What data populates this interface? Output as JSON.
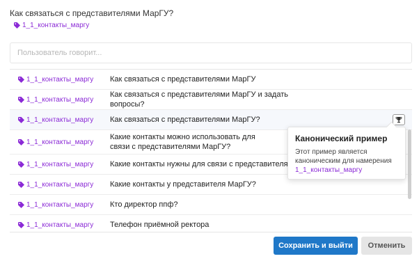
{
  "header": {
    "question": "Как связаться с представителями МарГУ?",
    "intent_tag": "1_1_контакты_маргу",
    "tag_icon": "tag-icon"
  },
  "input": {
    "placeholder": "Пользователь говорит...",
    "value": ""
  },
  "rows": [
    {
      "tag": "1_1_контакты_маргу",
      "text": "Как связаться с представителями МарГУ"
    },
    {
      "tag": "1_1_контакты_маргу",
      "text": "Как связаться с представителями МарГУ и задать вопросы?"
    },
    {
      "tag": "1_1_контакты_маргу",
      "text": "Как связаться с представителями МарГУ?"
    },
    {
      "tag": "1_1_контакты_маргу",
      "text": "Какие контакты можно использовать для связи с представителями МарГУ?"
    },
    {
      "tag": "1_1_контакты_маргу",
      "text": "Какие контакты нужны для связи с представителями МарГУ?"
    },
    {
      "tag": "1_1_контакты_маргу",
      "text": "Какие контакты у представителя МарГУ?"
    },
    {
      "tag": "1_1_контакты_маргу",
      "text": "Кто директор ппф?"
    },
    {
      "tag": "1_1_контакты_маргу",
      "text": "Телефон приёмной ректора"
    }
  ],
  "tooltip": {
    "title": "Канонический пример",
    "body": "Этот пример является каноническим для намерения",
    "tag": "1_1_контакты_маргу",
    "icon": "trophy-icon"
  },
  "footer": {
    "save_label": "Сохранить и выйти",
    "cancel_label": "Отменить"
  },
  "colors": {
    "tag": "#8b2ad6",
    "primary": "#1f78c8",
    "secondary": "#e5e5e5",
    "highlight_row": "#f6f8fc"
  }
}
